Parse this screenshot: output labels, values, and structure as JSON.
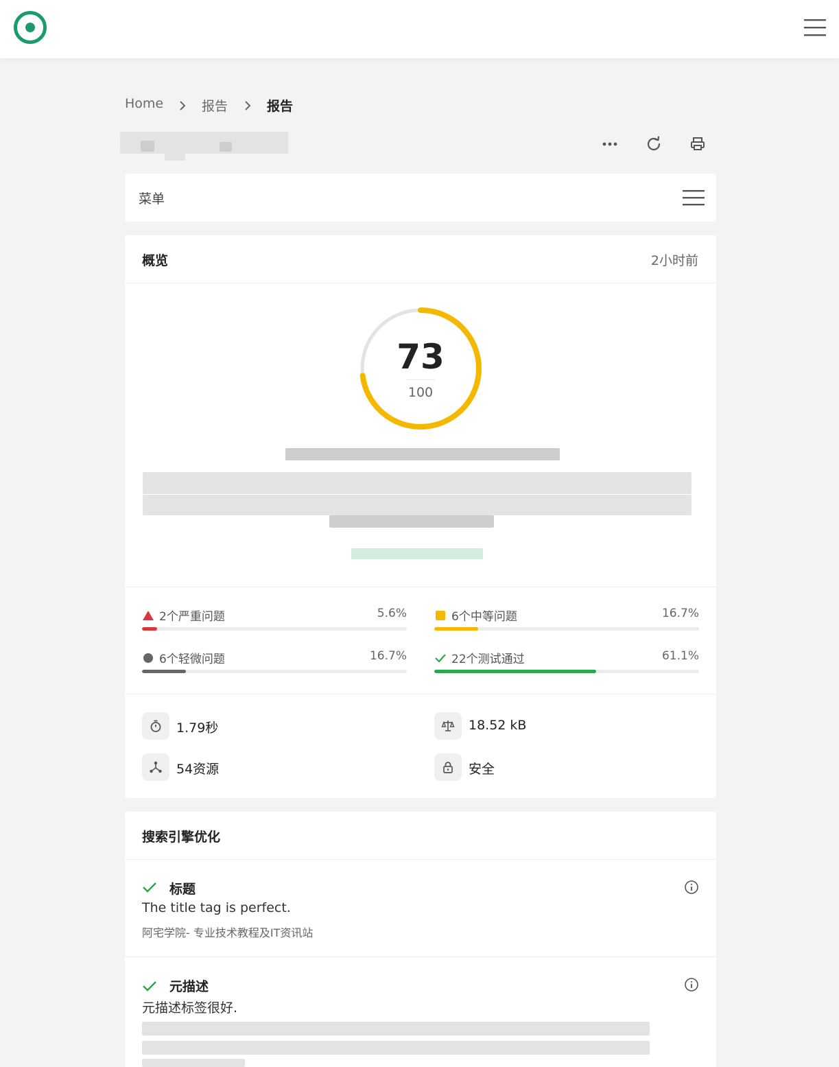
{
  "header": {
    "logo_icon": "target-logo-icon",
    "menu_icon": "hamburger-icon"
  },
  "breadcrumb": [
    "Home",
    "报告",
    "报告"
  ],
  "actions": {
    "more_icon": "more-horizontal-icon",
    "refresh_icon": "refresh-icon",
    "print_icon": "printer-icon"
  },
  "menu": {
    "label": "菜单"
  },
  "overview": {
    "title": "概览",
    "time": "2小时前",
    "score": "73",
    "max": "100",
    "score_fraction": 0.73,
    "stats": [
      {
        "label": "2个严重问题",
        "percent": "5.6%",
        "fraction": 0.056,
        "color": "#d9363e",
        "icon": "triangle-icon"
      },
      {
        "label": "6个中等问题",
        "percent": "16.7%",
        "fraction": 0.167,
        "color": "#f5b800",
        "icon": "square-icon"
      },
      {
        "label": "6个轻微问题",
        "percent": "16.7%",
        "fraction": 0.167,
        "color": "#666666",
        "icon": "circle-icon"
      },
      {
        "label": "22个测试通过",
        "percent": "61.1%",
        "fraction": 0.611,
        "color": "#2ba84a",
        "icon": "check-icon"
      }
    ],
    "metrics": [
      {
        "value": "1.79秒",
        "icon": "stopwatch-icon"
      },
      {
        "value": "18.52 kB",
        "icon": "scale-icon"
      },
      {
        "value": "54资源",
        "icon": "share-nodes-icon"
      },
      {
        "value": "安全",
        "icon": "lock-icon"
      }
    ]
  },
  "seo": {
    "title": "搜索引擎优化",
    "items": [
      {
        "title": "标题",
        "desc": "The title tag is perfect.",
        "sub": "阿宅学院- 专业技术教程及IT资讯站"
      },
      {
        "title": "元描述",
        "desc": "元描述标签很好.",
        "sub": ""
      }
    ]
  },
  "colors": {
    "accent": "#1a9b6c",
    "gauge": "#f5b800",
    "track": "#e3e3e3"
  }
}
